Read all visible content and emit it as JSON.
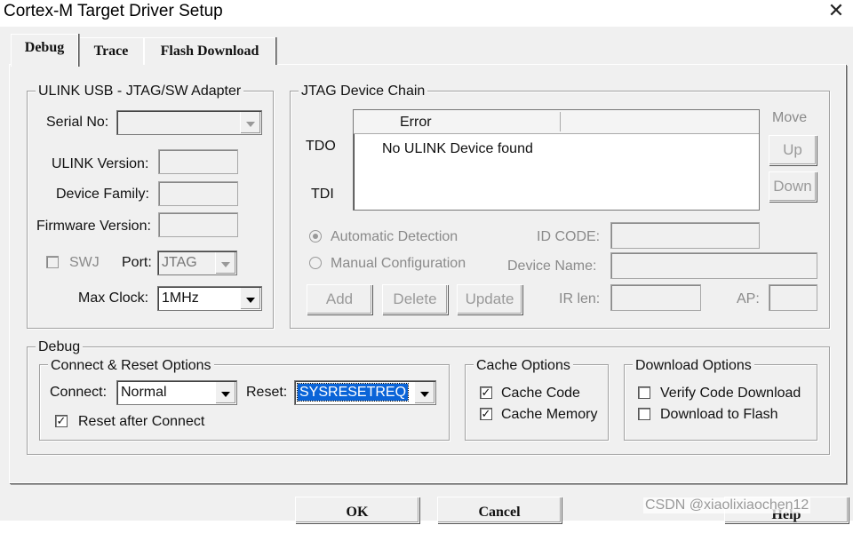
{
  "window": {
    "title": "Cortex-M Target Driver Setup",
    "close_glyph": "✕"
  },
  "tabs": [
    {
      "label": "Debug"
    },
    {
      "label": "Trace"
    },
    {
      "label": "Flash Download"
    }
  ],
  "ulink": {
    "group_title": "ULINK USB - JTAG/SW Adapter",
    "serial_label": "Serial No:",
    "serial_value": "",
    "version_label": "ULINK Version:",
    "family_label": "Device Family:",
    "firmware_label": "Firmware Version:",
    "swj_label": "SWJ",
    "port_label": "Port:",
    "port_value": "JTAG",
    "maxclock_label": "Max Clock:",
    "maxclock_value": "1MHz"
  },
  "jtag": {
    "group_title": "JTAG Device Chain",
    "tdo_label": "TDO",
    "tdi_label": "TDI",
    "col_header": "Error",
    "message": "No ULINK Device found",
    "move_label": "Move",
    "up_button": "Up",
    "down_button": "Down",
    "auto_label": "Automatic Detection",
    "manual_label": "Manual Configuration",
    "idcode_label": "ID CODE:",
    "devicename_label": "Device Name:",
    "add_button": "Add",
    "delete_button": "Delete",
    "update_button": "Update",
    "irlen_label": "IR len:",
    "ap_label": "AP:"
  },
  "debug": {
    "group_title": "Debug",
    "connect_group_title": "Connect & Reset Options",
    "connect_label": "Connect:",
    "connect_value": "Normal",
    "reset_label": "Reset:",
    "reset_value": "SYSRESETREQ",
    "reset_after_label": "Reset after Connect",
    "cache_group_title": "Cache Options",
    "cache_code_label": "Cache Code",
    "cache_memory_label": "Cache Memory",
    "download_group_title": "Download Options",
    "verify_label": "Verify Code Download",
    "download_flash_label": "Download to Flash"
  },
  "footer": {
    "ok_button": "OK",
    "cancel_button": "Cancel",
    "help_button": "Help",
    "watermark": "CSDN @xiaolixiaochen12"
  },
  "check_glyph": "✓"
}
